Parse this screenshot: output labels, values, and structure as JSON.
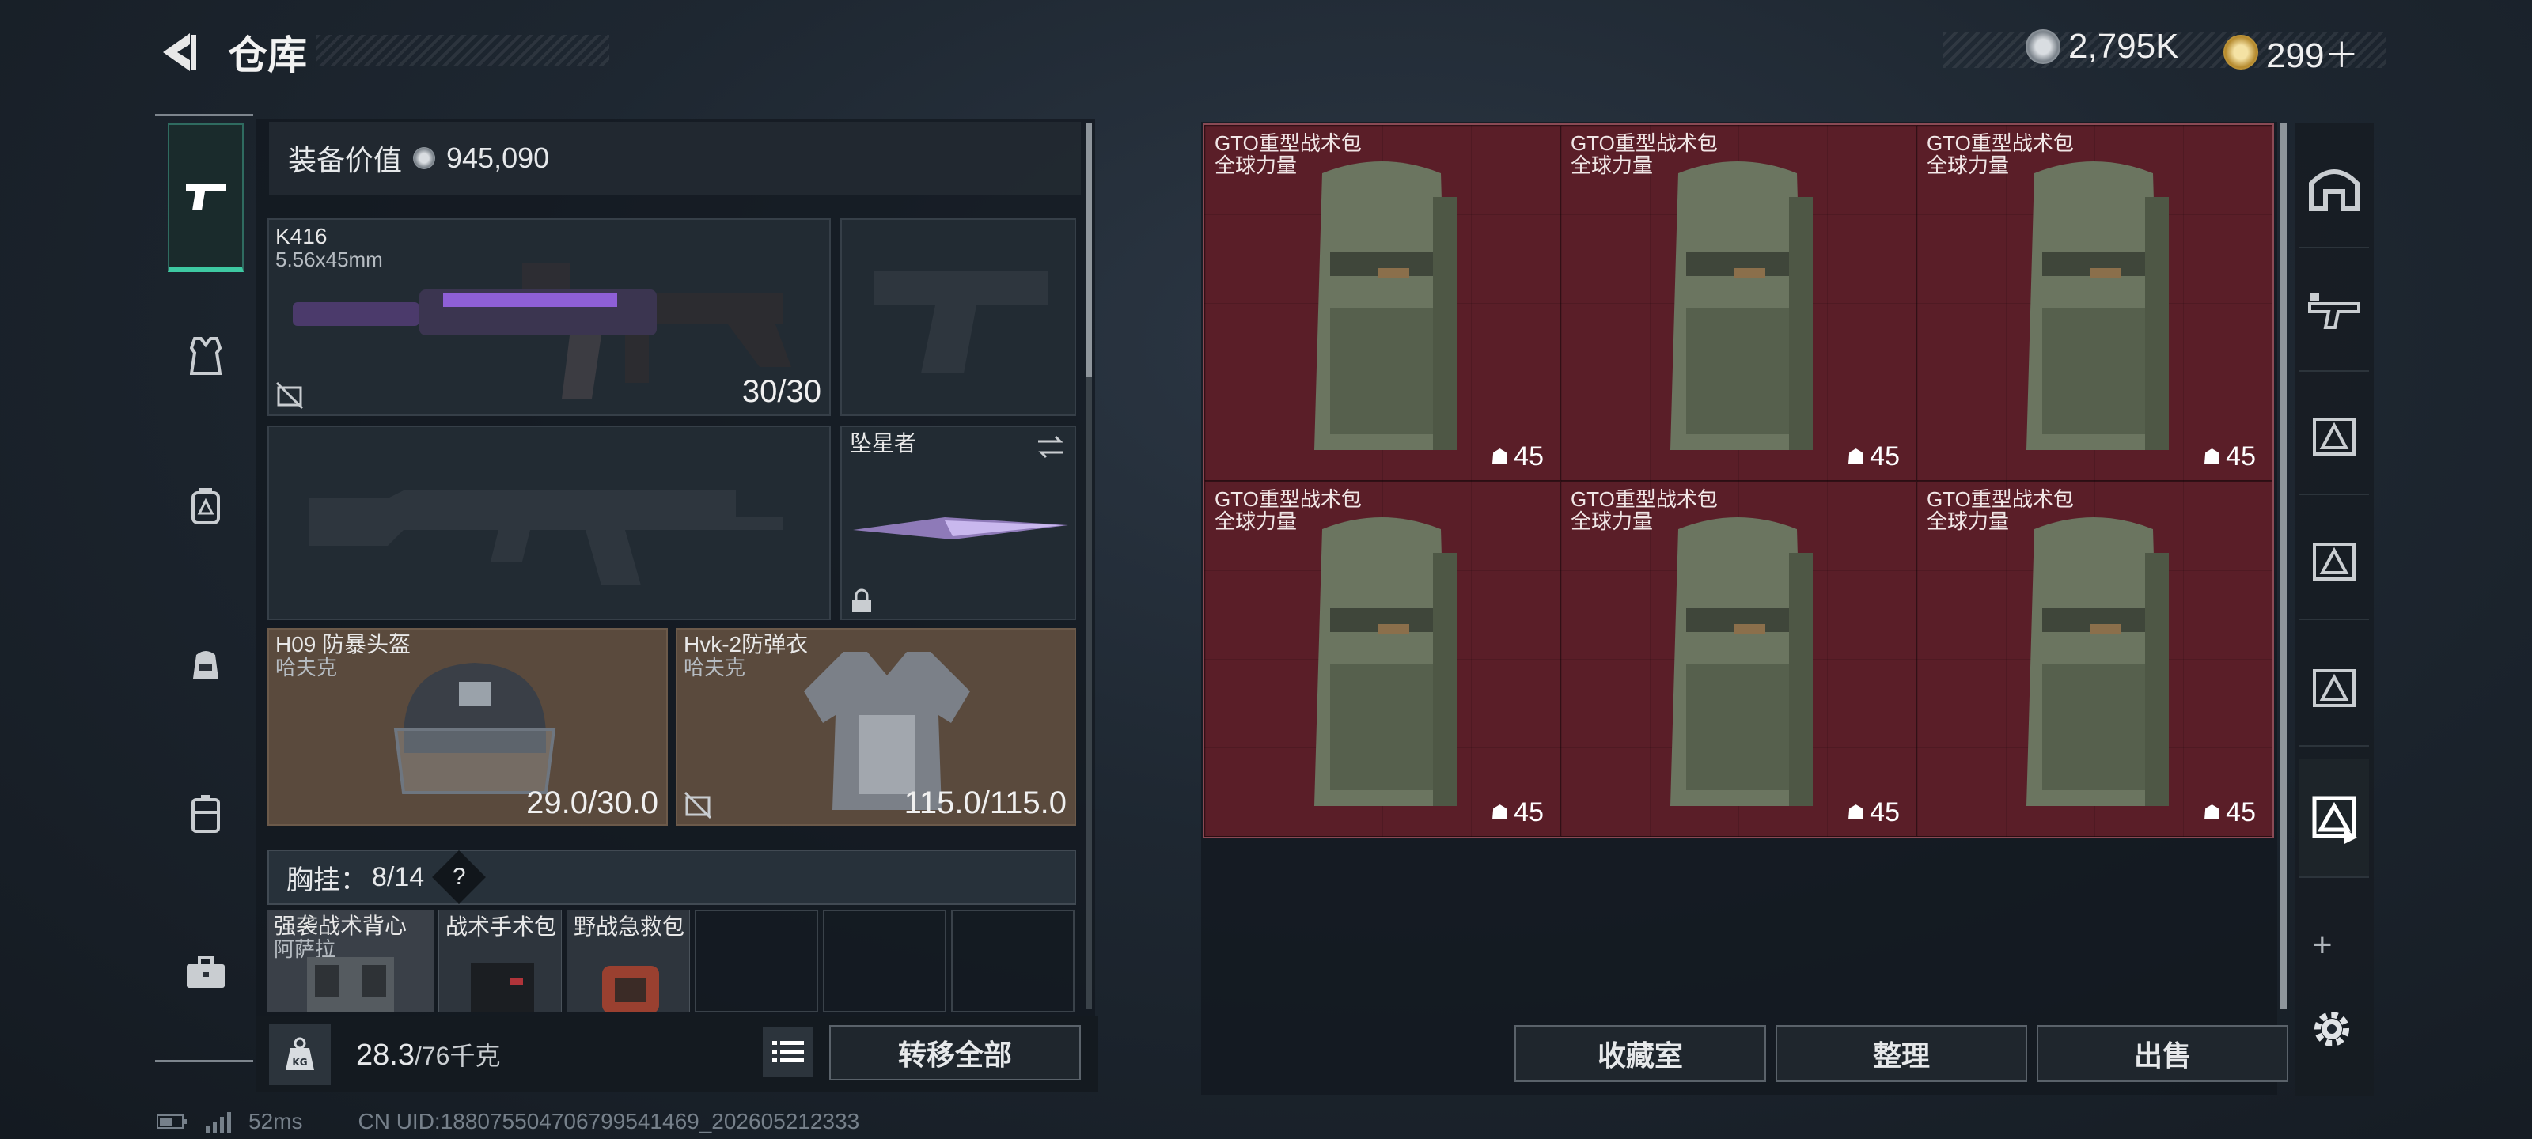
{
  "header": {
    "title": "仓库"
  },
  "currency": [
    {
      "icon": "silver-coin-icon",
      "value": "2,795K"
    },
    {
      "icon": "gold-coin-icon",
      "value": "299＋"
    }
  ],
  "left_rail": [
    "pistol-icon",
    "armor-vest-icon",
    "chest-rig-icon",
    "backpack-icon",
    "container-icon",
    "briefcase-icon"
  ],
  "equipment": {
    "value_label": "装备价值",
    "value": "945,090",
    "primary": {
      "name": "K416",
      "ammo": "5.56x45mm",
      "count": "30/30"
    },
    "melee": {
      "name": "坠星者"
    },
    "helmet": {
      "name": "H09 防暴头盔",
      "brand": "哈夫克",
      "durability": "29.0/30.0"
    },
    "armor": {
      "name": "Hvk-2防弹衣",
      "brand": "哈夫克",
      "durability": "115.0/115.0"
    },
    "chest_rig": {
      "label": "胸挂：",
      "slots": "8/14",
      "help": "?"
    },
    "rig_items": [
      {
        "name": "强袭战术背心",
        "brand": "阿萨拉"
      },
      {
        "name": "战术手术包"
      },
      {
        "name": "野战急救包"
      }
    ]
  },
  "bottom": {
    "weight": "28.3",
    "weight_max": "/76千克",
    "transfer_label": "转移全部"
  },
  "storage": {
    "items": [
      {
        "name": "GTO重型战术包",
        "brand": "全球力量",
        "count": "45"
      },
      {
        "name": "GTO重型战术包",
        "brand": "全球力量",
        "count": "45"
      },
      {
        "name": "GTO重型战术包",
        "brand": "全球力量",
        "count": "45"
      },
      {
        "name": "GTO重型战术包",
        "brand": "全球力量",
        "count": "45"
      },
      {
        "name": "GTO重型战术包",
        "brand": "全球力量",
        "count": "45"
      },
      {
        "name": "GTO重型战术包",
        "brand": "全球力量",
        "count": "45"
      }
    ],
    "buttons": {
      "collect": "收藏室",
      "sort": "整理",
      "sell": "出售"
    }
  },
  "right_tabs": {
    "plus": "+"
  },
  "footer": {
    "ping": "52ms",
    "uid": "CN UID:1880755047067995414​69_202605212333"
  },
  "colors": {
    "accent": "#3ec9a2",
    "grid_bg": "#5b1f29",
    "card_brown": "#5a4a3d"
  }
}
